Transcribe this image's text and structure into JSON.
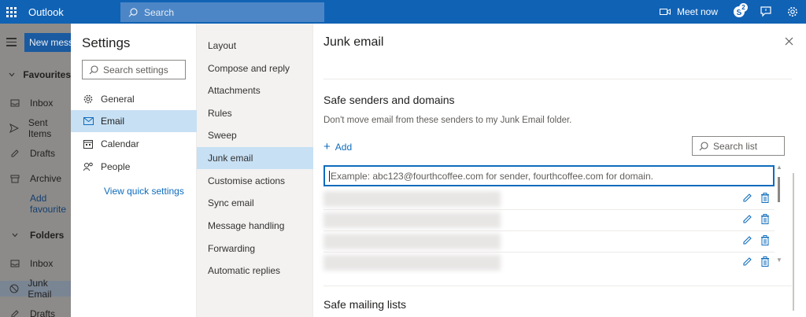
{
  "app": {
    "brand": "Outlook",
    "search_placeholder": "Search",
    "meet_now": "Meet now",
    "badge_count": "2"
  },
  "left_nav": {
    "new_message": "New message",
    "items": [
      {
        "label": "Favourites",
        "type": "heading"
      },
      {
        "label": "Inbox"
      },
      {
        "label": "Sent Items"
      },
      {
        "label": "Drafts"
      },
      {
        "label": "Archive"
      },
      {
        "label": "Add favourite"
      },
      {
        "label": "Folders",
        "type": "heading"
      },
      {
        "label": "Inbox"
      },
      {
        "label": "Junk Email",
        "selected": true
      },
      {
        "label": "Drafts"
      }
    ]
  },
  "settings": {
    "title": "Settings",
    "search_placeholder": "Search settings",
    "categories": [
      {
        "label": "General",
        "icon": "gear-icon"
      },
      {
        "label": "Email",
        "icon": "mail-icon",
        "selected": true
      },
      {
        "label": "Calendar",
        "icon": "calendar-icon"
      },
      {
        "label": "People",
        "icon": "people-icon"
      }
    ],
    "quick_settings": "View quick settings",
    "subsections": [
      "Layout",
      "Compose and reply",
      "Attachments",
      "Rules",
      "Sweep",
      "Junk email",
      "Customise actions",
      "Sync email",
      "Message handling",
      "Forwarding",
      "Automatic replies"
    ],
    "selected_subsection": "Junk email"
  },
  "pane": {
    "title": "Junk email",
    "safe_senders_title": "Safe senders and domains",
    "safe_senders_desc": "Don't move email from these senders to my Junk Email folder.",
    "add_label": "Add",
    "search_list_placeholder": "Search list",
    "input_placeholder": "Example: abc123@fourthcoffee.com for sender, fourthcoffee.com for domain.",
    "rows_count": 4,
    "safe_mailing_title": "Safe mailing lists"
  },
  "colors": {
    "accent": "#0f6cbd",
    "topbar": "#1062b5",
    "selected": "#c7e0f4"
  }
}
